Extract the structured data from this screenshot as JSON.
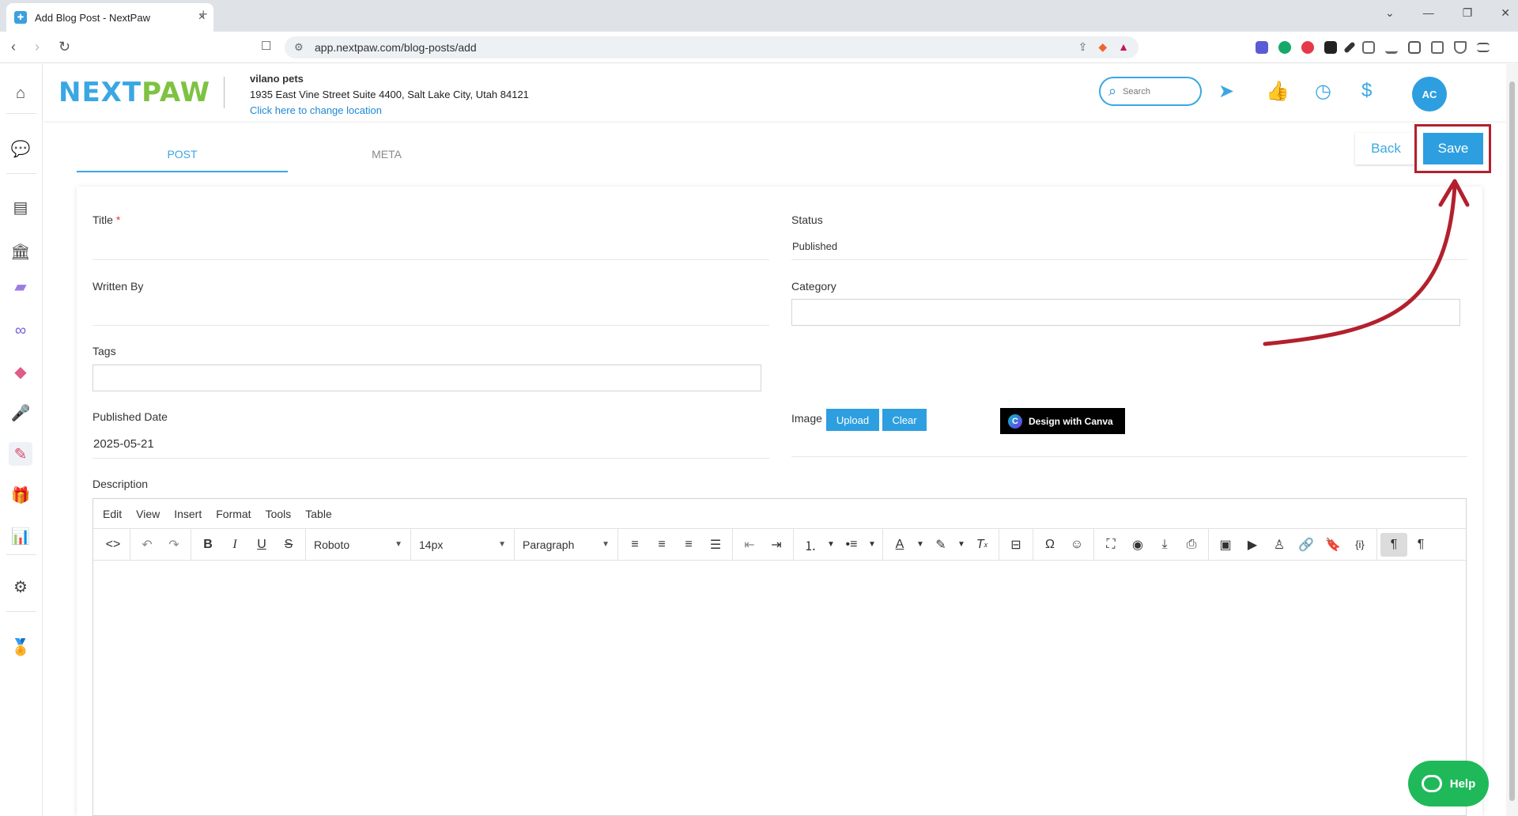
{
  "browser": {
    "tab_title": "Add Blog Post - NextPaw",
    "url": "app.nextpaw.com/blog-posts/add"
  },
  "header": {
    "logo_next": "NEXT",
    "logo_paw": "PAW",
    "location_name": "vilano pets",
    "location_address": "1935 East Vine Street Suite 4400, Salt Lake City, Utah 84121",
    "location_link": "Click here to change location",
    "search_placeholder": "Search",
    "avatar_initials": "AC"
  },
  "tabs": {
    "post": "POST",
    "meta": "META"
  },
  "actions": {
    "back": "Back",
    "save": "Save"
  },
  "form": {
    "title_label": "Title",
    "title_required": "*",
    "status_label": "Status",
    "status_value": "Published",
    "written_by_label": "Written By",
    "category_label": "Category",
    "tags_label": "Tags",
    "published_date_label": "Published Date",
    "published_date_value": "2025-05-21",
    "image_label": "Image",
    "upload_label": "Upload",
    "clear_label": "Clear",
    "canva_label": "Design with Canva",
    "description_label": "Description"
  },
  "editor": {
    "menu": [
      "Edit",
      "View",
      "Insert",
      "Format",
      "Tools",
      "Table"
    ],
    "font_family": "Roboto",
    "font_size": "14px",
    "block_format": "Paragraph"
  },
  "help": {
    "label": "Help"
  },
  "colors": {
    "brand_blue": "#3aa7e3",
    "brand_green": "#7ec242",
    "annotation_red": "#b3202d",
    "help_green": "#1fb95a"
  }
}
